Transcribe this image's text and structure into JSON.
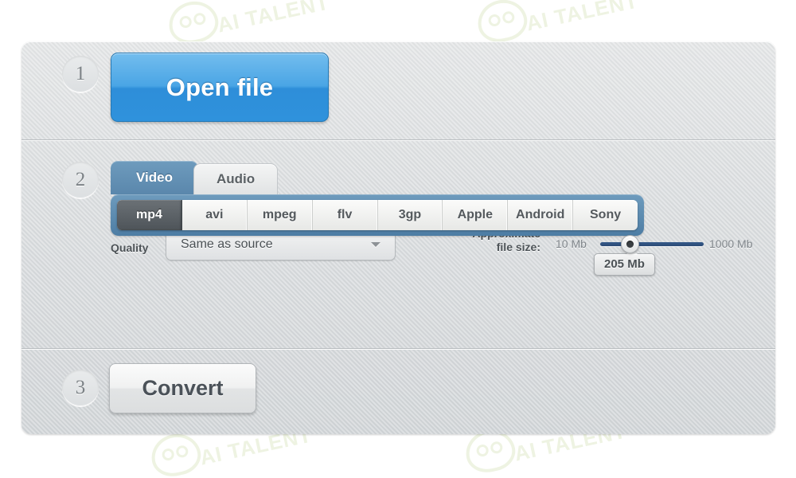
{
  "app": {
    "watermark_text": "AI TALENT"
  },
  "steps": {
    "one": "1",
    "two": "2",
    "three": "3"
  },
  "step1": {
    "open_file_label": "Open file"
  },
  "step2": {
    "tabs": [
      {
        "label": "Video",
        "active": true
      },
      {
        "label": "Audio",
        "active": false
      }
    ],
    "formats": [
      {
        "label": "mp4",
        "active": true
      },
      {
        "label": "avi",
        "active": false
      },
      {
        "label": "mpeg",
        "active": false
      },
      {
        "label": "flv",
        "active": false
      },
      {
        "label": "3gp",
        "active": false
      },
      {
        "label": "Apple",
        "active": false
      },
      {
        "label": "Android",
        "active": false
      },
      {
        "label": "Sony",
        "active": false
      }
    ],
    "quality": {
      "label": "Quality",
      "selected": "Same as source",
      "options": [
        "Same as source"
      ]
    },
    "filesize": {
      "label_line1": "Approximate",
      "label_line2": "file size:",
      "min_label": "10 Mb",
      "max_label": "1000 Mb",
      "current_label": "205 Mb",
      "min": 10,
      "max": 1000,
      "value": 205
    }
  },
  "step3": {
    "convert_label": "Convert"
  },
  "colors": {
    "accent_blue": "#2f92dc",
    "tab_blue": "#5a87ac",
    "track_blue": "#34598a",
    "panel_bg": "#d8dbdd"
  }
}
